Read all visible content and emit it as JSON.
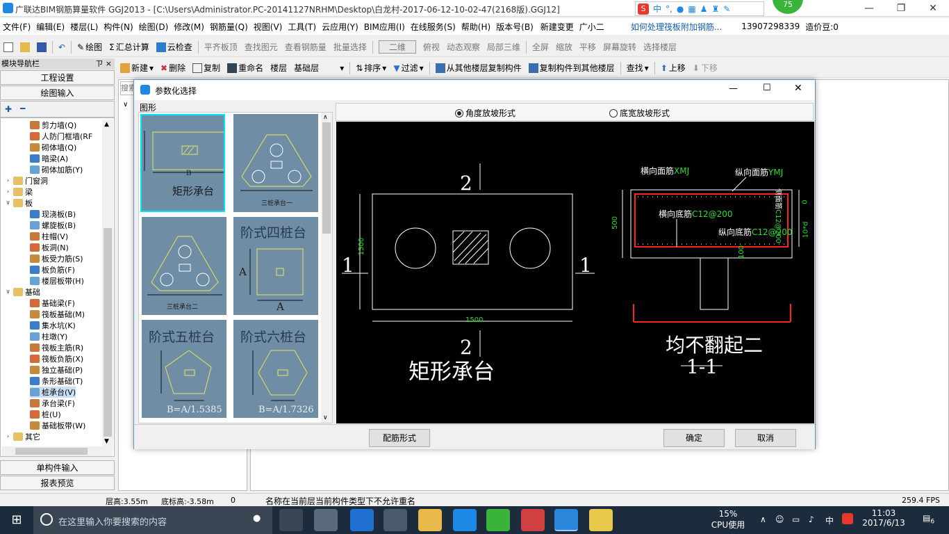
{
  "app": {
    "title": "广联达BIM钢筋算量软件 GGJ2013 - [C:\\Users\\Administrator.PC-20141127NRHM\\Desktop\\白龙村-2017-06-12-10-02-47(2168版).GGJ12]",
    "badge": "75",
    "ime": "中"
  },
  "menubar": [
    "文件(F)",
    "编辑(E)",
    "楼层(L)",
    "构件(N)",
    "绘图(D)",
    "修改(M)",
    "钢筋量(Q)",
    "视图(V)",
    "工具(T)",
    "云应用(Y)",
    "BIM应用(I)",
    "在线服务(S)",
    "帮助(H)",
    "版本号(B)",
    "新建变更",
    "广小二",
    "如何处理筏板附加钢筋...",
    "13907298339",
    "造价豆:0"
  ],
  "toolbar1": [
    "绘图",
    "汇总计算",
    "云检查",
    "平齐板顶",
    "查找图元",
    "查看钢筋量",
    "批量选择",
    "二维",
    "俯视",
    "动态观察",
    "局部三维",
    "全屏",
    "缩放",
    "平移",
    "屏幕旋转",
    "选择楼层"
  ],
  "toolbar2": [
    "新建",
    "删除",
    "复制",
    "重命名",
    "楼层",
    "基础层",
    "排序",
    "过滤",
    "从其他楼层复制构件",
    "复制构件到其他楼层",
    "查找",
    "上移",
    "下移"
  ],
  "nav": {
    "header": "模块导航栏",
    "pin": "ㄗ ×",
    "btn_project": "工程设置",
    "btn_draw": "绘图输入",
    "btn_single": "单构件输入",
    "btn_report": "报表预览",
    "tree": [
      {
        "label": "剪力墙(Q)",
        "level": 2
      },
      {
        "label": "人防门框墙(RF",
        "level": 2
      },
      {
        "label": "砌体墙(Q)",
        "level": 2
      },
      {
        "label": "暗梁(A)",
        "level": 2
      },
      {
        "label": "砌体加筋(Y)",
        "level": 2
      },
      {
        "label": "门窗洞",
        "level": 1,
        "exp": "+"
      },
      {
        "label": "梁",
        "level": 1,
        "exp": "+"
      },
      {
        "label": "板",
        "level": 1,
        "exp": "-"
      },
      {
        "label": "现浇板(B)",
        "level": 2
      },
      {
        "label": "螺旋板(B)",
        "level": 2
      },
      {
        "label": "柱帽(V)",
        "level": 2
      },
      {
        "label": "板洞(N)",
        "level": 2
      },
      {
        "label": "板受力筋(S)",
        "level": 2
      },
      {
        "label": "板负筋(F)",
        "level": 2
      },
      {
        "label": "楼层板带(H)",
        "level": 2
      },
      {
        "label": "基础",
        "level": 1,
        "exp": "-"
      },
      {
        "label": "基础梁(F)",
        "level": 2
      },
      {
        "label": "筏板基础(M)",
        "level": 2
      },
      {
        "label": "集水坑(K)",
        "level": 2
      },
      {
        "label": "柱墩(Y)",
        "level": 2
      },
      {
        "label": "筏板主筋(R)",
        "level": 2
      },
      {
        "label": "筏板负筋(X)",
        "level": 2
      },
      {
        "label": "独立基础(P)",
        "level": 2
      },
      {
        "label": "条形基础(T)",
        "level": 2
      },
      {
        "label": "桩承台(V)",
        "level": 2,
        "selected": true
      },
      {
        "label": "承台梁(F)",
        "level": 2
      },
      {
        "label": "桩(U)",
        "level": 2
      },
      {
        "label": "基础板带(W)",
        "level": 2
      },
      {
        "label": "其它",
        "level": 1,
        "exp": "+"
      }
    ]
  },
  "search_placeholder": "搜索",
  "dialog": {
    "title": "参数化选择",
    "group_label": "图形",
    "radio1": "角度放坡形式",
    "radio2": "底宽放坡形式",
    "thumbs": [
      {
        "label": "矩形承台",
        "sub": "B"
      },
      {
        "label": "三桩承台一"
      },
      {
        "label": "三桩承台二"
      },
      {
        "label": "阶式四桩台",
        "sub": "A"
      },
      {
        "label": "阶式五桩台",
        "sub": "B=A/1.5385"
      },
      {
        "label": "阶式六桩台",
        "sub": "B=A/1.7326"
      }
    ],
    "btn_rebar": "配筋形式",
    "btn_ok": "确定",
    "btn_cancel": "取消"
  },
  "drawing": {
    "section2_top": "2",
    "section2_bottom": "2",
    "section1_left": "1",
    "section1_right": "1",
    "dim_w": "1500",
    "dim_h": "1500",
    "plan_title": "矩形承台",
    "h_top_label": "横向面筋",
    "h_top_val": "XMJ",
    "v_top_label": "纵向面筋",
    "v_top_val": "YMJ",
    "h_bot_label": "横向底筋",
    "h_bot_val": "C12@200",
    "v_bot_label": "纵向底筋",
    "v_bot_val": "C12@200",
    "side_label": "侧面筋",
    "side_val": "C12@200",
    "dim_500": "500",
    "dim_0": "0",
    "dim_10d": "10*d",
    "dim_100": "100",
    "section_title": "均不翻起二",
    "section_num": "1-1"
  },
  "status": {
    "floor_height": "层高:3.55m",
    "bottom_elev": "底标高:-3.58m",
    "zero": "0",
    "message": "名称在当前层当前构件类型下不允许重名",
    "fps": "259.4 FPS"
  },
  "taskbar": {
    "search": "在这里输入你要搜索的内容",
    "cpu": "15%",
    "cpu_label": "CPU使用",
    "ime": "中",
    "time": "11:03",
    "date": "2017/6/13",
    "notif": "6"
  },
  "colors": {
    "titlebar_icon": "#1e88e5",
    "drawing_bg": "#000000",
    "thumb_bg": "#6f8ea6",
    "selected": "#00e5ff",
    "rebar_red": "#ff2020",
    "label_green": "#22e022"
  }
}
